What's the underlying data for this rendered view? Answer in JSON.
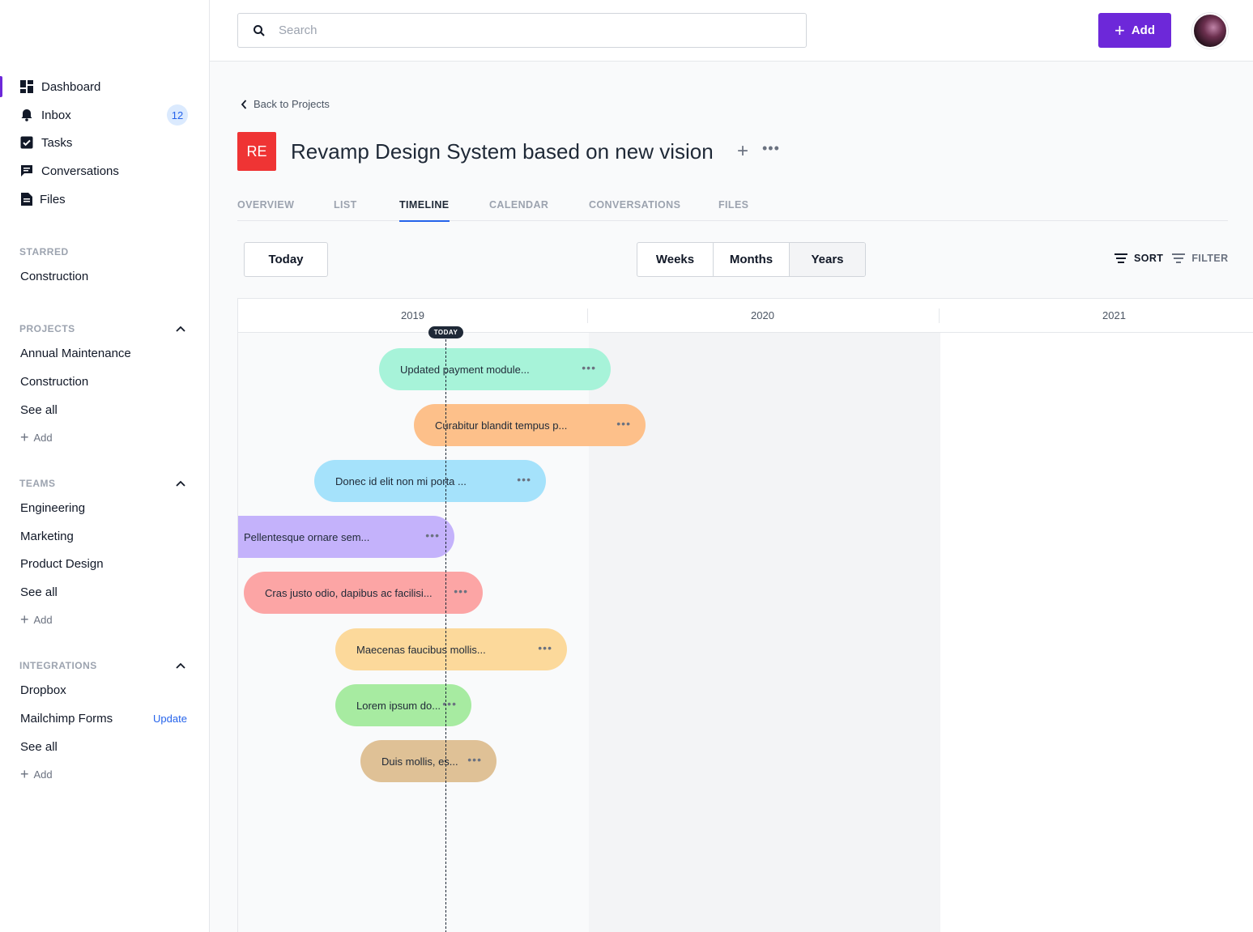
{
  "sidebar": {
    "nav": [
      {
        "label": "Dashboard",
        "icon": "dashboard-icon"
      },
      {
        "label": "Inbox",
        "icon": "bell-icon",
        "badge": "12"
      },
      {
        "label": "Tasks",
        "icon": "checkbox-icon"
      },
      {
        "label": "Conversations",
        "icon": "chat-icon"
      },
      {
        "label": "Files",
        "icon": "file-icon"
      }
    ],
    "starred": {
      "title": "STARRED",
      "items": [
        "Construction"
      ]
    },
    "projects": {
      "title": "PROJECTS",
      "items": [
        "Annual Maintenance",
        "Construction",
        "See all"
      ],
      "add": "Add"
    },
    "teams": {
      "title": "TEAMS",
      "items": [
        "Engineering",
        "Marketing",
        "Product Design",
        "See all"
      ],
      "add": "Add"
    },
    "integrations": {
      "title": "INTEGRATIONS",
      "items": [
        "Dropbox",
        "Mailchimp Forms",
        "See all"
      ],
      "update": "Update",
      "add": "Add"
    }
  },
  "topbar": {
    "search_placeholder": "Search",
    "add_label": "Add"
  },
  "project": {
    "back_label": "Back to Projects",
    "initials": "RE",
    "title": "Revamp Design System based on new vision",
    "accent": "#ef3434"
  },
  "tabs": [
    "OVERVIEW",
    "LIST",
    "TIMELINE",
    "CALENDAR",
    "CONVERSATIONS",
    "FILES"
  ],
  "active_tab": "TIMELINE",
  "controls": {
    "today_label": "Today",
    "views": [
      "Weeks",
      "Months",
      "Years"
    ],
    "selected_view": "Years",
    "sort_label": "SORT",
    "filter_label": "FILTER"
  },
  "timeline": {
    "years": [
      "2019",
      "2020",
      "2021"
    ],
    "today_label": "TODAY",
    "tasks": [
      {
        "label": "Updated payment module...",
        "color": "#a7f3d9"
      },
      {
        "label": "Curabitur blandit tempus p...",
        "color": "#fdc08a"
      },
      {
        "label": "Donec id elit non mi porta ...",
        "color": "#a5e2fb"
      },
      {
        "label": "Pellentesque ornare sem...",
        "color": "#c4b2fb"
      },
      {
        "label": "Cras justo odio, dapibus ac facilisi...",
        "color": "#fca5a5"
      },
      {
        "label": "Maecenas faucibus mollis...",
        "color": "#fcd99b"
      },
      {
        "label": "Lorem ipsum do...",
        "color": "#a7eba1"
      },
      {
        "label": "Duis mollis, es...",
        "color": "#dfc196"
      }
    ]
  }
}
